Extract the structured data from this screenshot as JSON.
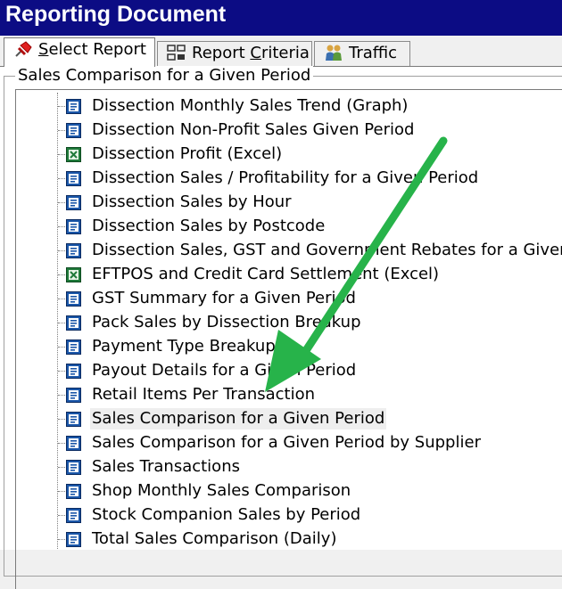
{
  "window": {
    "title": "Reporting Document"
  },
  "tabs": [
    {
      "label_prefix": "",
      "label_u": "S",
      "label_rest": "elect Report",
      "icon": "pin-icon",
      "active": true
    },
    {
      "label_prefix": "Report ",
      "label_u": "C",
      "label_rest": "riteria",
      "icon": "criteria-icon",
      "active": false
    },
    {
      "label_prefix": "",
      "label_u": "",
      "label_rest": "Traffic",
      "icon": "people-icon",
      "active": false
    }
  ],
  "group": {
    "title": "Sales Comparison for a Given Period"
  },
  "reports": [
    {
      "label": "Dissection Monthly Sales Trend (Graph)",
      "icon": "report-icon"
    },
    {
      "label": "Dissection Non-Profit Sales Given Period",
      "icon": "report-icon"
    },
    {
      "label": "Dissection Profit (Excel)",
      "icon": "excel-icon"
    },
    {
      "label": "Dissection Sales / Profitability for a Given Period",
      "icon": "report-icon"
    },
    {
      "label": "Dissection Sales by Hour",
      "icon": "report-icon"
    },
    {
      "label": "Dissection Sales by Postcode",
      "icon": "report-icon"
    },
    {
      "label": "Dissection Sales, GST and Government Rebates for a Given",
      "icon": "report-icon"
    },
    {
      "label": "EFTPOS and Credit Card Settlement (Excel)",
      "icon": "excel-icon"
    },
    {
      "label": "GST Summary for a Given Period",
      "icon": "report-icon"
    },
    {
      "label": "Pack Sales by Dissection Breakup",
      "icon": "report-icon"
    },
    {
      "label": "Payment Type Breakup",
      "icon": "report-icon"
    },
    {
      "label": "Payout Details for a Given Period",
      "icon": "report-icon"
    },
    {
      "label": "Retail Items Per Transaction",
      "icon": "report-icon"
    },
    {
      "label": "Sales Comparison for a Given Period",
      "icon": "report-icon",
      "selected": true
    },
    {
      "label": "Sales Comparison for a Given Period by Supplier",
      "icon": "report-icon"
    },
    {
      "label": "Sales Transactions",
      "icon": "report-icon"
    },
    {
      "label": "Shop Monthly Sales Comparison",
      "icon": "report-icon"
    },
    {
      "label": "Stock Companion Sales by Period",
      "icon": "report-icon"
    },
    {
      "label": "Total Sales Comparison (Daily)",
      "icon": "report-icon"
    }
  ],
  "colors": {
    "titlebar": "#0c0c84",
    "arrow": "#27b34a",
    "report_icon": "#1a56a8",
    "excel_icon": "#1f7a3a",
    "selection": "#eeeeee"
  }
}
